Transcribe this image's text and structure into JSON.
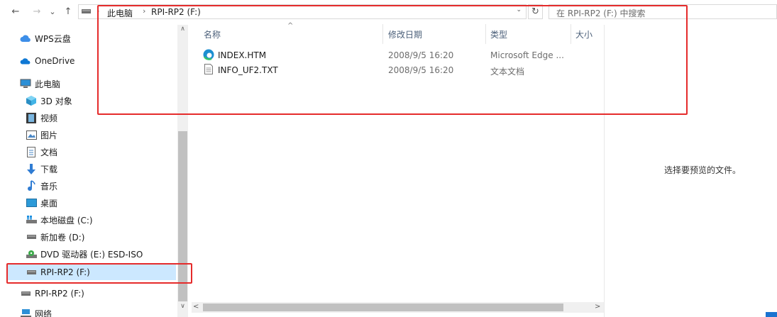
{
  "toolbar": {
    "back": "←",
    "forward": "→",
    "history": "⌄",
    "up": "↑",
    "breadcrumb": [
      "此电脑",
      "RPI-RP2 (F:)"
    ],
    "refresh": "↻",
    "search_placeholder": "在 RPI-RP2 (F:) 中搜索"
  },
  "sidebar": {
    "items": [
      {
        "label": "WPS云盘",
        "icon": "cloud-icon"
      },
      {
        "label": "OneDrive",
        "icon": "onedrive-icon"
      },
      {
        "label": "此电脑",
        "icon": "computer-icon"
      },
      {
        "label": "3D 对象",
        "icon": "cube-icon"
      },
      {
        "label": "视频",
        "icon": "video-icon"
      },
      {
        "label": "图片",
        "icon": "picture-icon"
      },
      {
        "label": "文档",
        "icon": "document-icon"
      },
      {
        "label": "下载",
        "icon": "download-icon"
      },
      {
        "label": "音乐",
        "icon": "music-icon"
      },
      {
        "label": "桌面",
        "icon": "desktop-icon"
      },
      {
        "label": "本地磁盘 (C:)",
        "icon": "windows-drive-icon"
      },
      {
        "label": "新加卷 (D:)",
        "icon": "drive-icon"
      },
      {
        "label": "DVD 驱动器 (E:) ESD-ISO",
        "icon": "dvd-icon"
      },
      {
        "label": "RPI-RP2 (F:)",
        "icon": "drive-icon"
      },
      {
        "label": "RPI-RP2 (F:)",
        "icon": "drive-icon"
      },
      {
        "label": "网络",
        "icon": "network-icon"
      }
    ]
  },
  "columns": [
    "名称",
    "修改日期",
    "类型",
    "大小"
  ],
  "files": [
    {
      "name": "INDEX.HTM",
      "modified": "2008/9/5 16:20",
      "type": "Microsoft Edge ...",
      "icon": "edge-icon"
    },
    {
      "name": "INFO_UF2.TXT",
      "modified": "2008/9/5 16:20",
      "type": "文本文档",
      "icon": "text-file-icon"
    }
  ],
  "preview_text": "选择要预览的文件。",
  "colors": {
    "highlight": "#e52b2b",
    "selection": "#cce8ff"
  }
}
